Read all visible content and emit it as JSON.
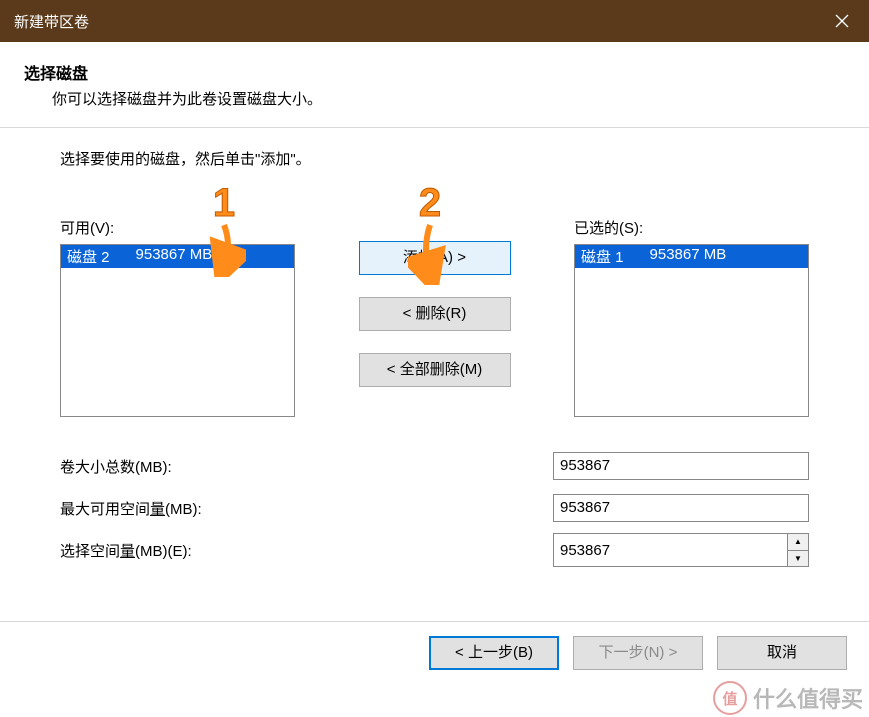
{
  "window": {
    "title": "新建带区卷"
  },
  "header": {
    "title": "选择磁盘",
    "subtitle": "你可以选择磁盘并为此卷设置磁盘大小。"
  },
  "instruction": "选择要使用的磁盘，然后单击\"添加\"。",
  "available": {
    "label": "可用(V):",
    "items": [
      {
        "name": "磁盘 2",
        "size": "953867 MB"
      }
    ]
  },
  "selected": {
    "label": "已选的(S):",
    "items": [
      {
        "name": "磁盘 1",
        "size": "953867 MB"
      }
    ]
  },
  "buttons": {
    "add": "添加(A) >",
    "remove": "< 删除(R)",
    "remove_all": "< 全部删除(M)"
  },
  "fields": {
    "total_label": "卷大小总数(MB):",
    "total_value": "953867",
    "max_label_pre": "最大可用空间",
    "max_label_u": "量",
    "max_label_post": "(MB):",
    "max_value": "953867",
    "select_label_pre": "选择空间",
    "select_label_u": "量",
    "select_label_post": "(MB)(E):",
    "select_value": "953867"
  },
  "footer": {
    "back": "< 上一步(B)",
    "next": "下一步(N) >",
    "cancel": "取消"
  },
  "annotations": {
    "one": "1",
    "two": "2"
  },
  "watermark": {
    "logo": "值",
    "text": "什么值得买"
  }
}
